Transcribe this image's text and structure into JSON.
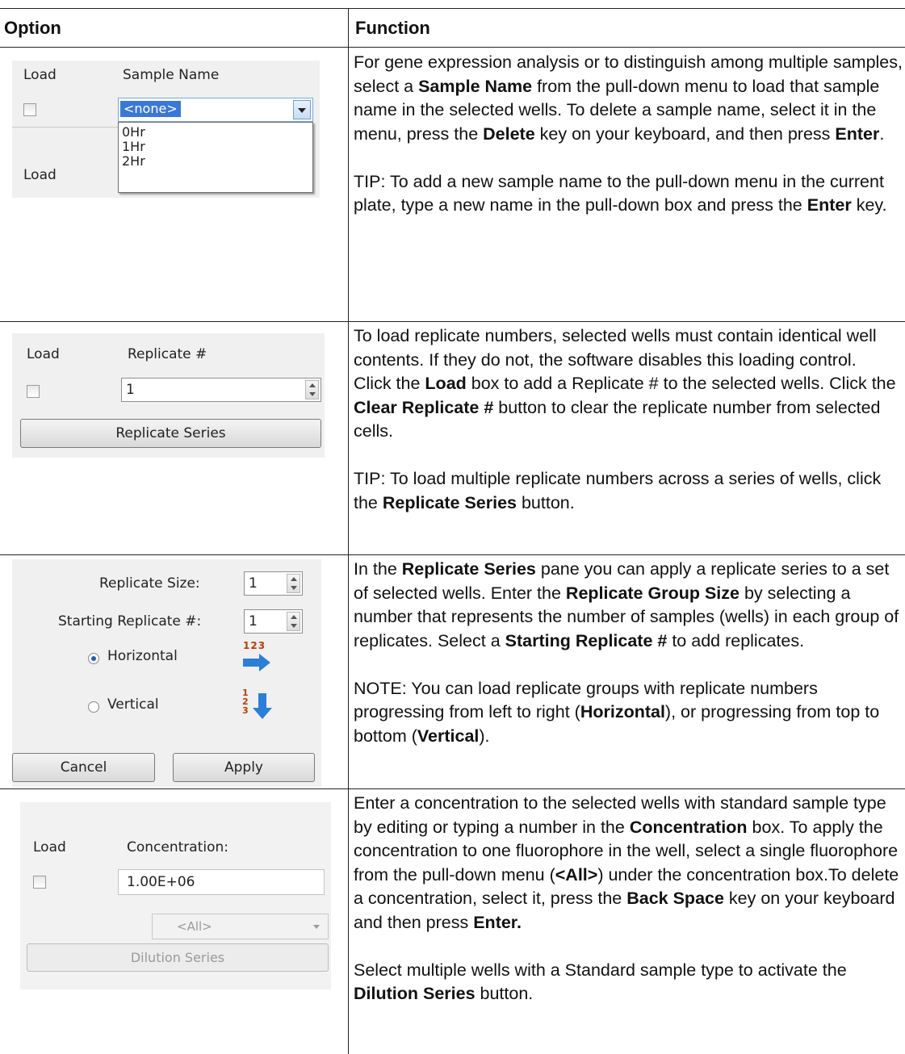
{
  "header": {
    "option": "Option",
    "function": "Function"
  },
  "rows": [
    {
      "shot": {
        "load_label": "Load",
        "sample_name_label": "Sample Name",
        "selected_value": "<none>",
        "options": [
          "0Hr",
          "1Hr",
          "2Hr"
        ],
        "load_label_2": "Load"
      },
      "text": {
        "p1_a": "For gene expression analysis or to distinguish among multiple samples, select a ",
        "p1_b1": "Sample Name",
        "p1_c": " from the pull-down menu to load that sample name in the selected wells. To delete a sample name, select it in the menu, press the ",
        "p1_b2": "Delete",
        "p1_d": " key on your keyboard, and then press ",
        "p1_b3": "Enter",
        "p1_e": ".",
        "p2_a": "TIP: To add a new sample name to the pull-down menu in the current plate, type a new name in the pull-down box and press the ",
        "p2_b": "Enter",
        "p2_c": " key."
      }
    },
    {
      "shot": {
        "load_label": "Load",
        "replicate_label": "Replicate #",
        "replicate_value": "1",
        "series_button": "Replicate Series"
      },
      "text": {
        "p1": "To load replicate numbers, selected wells must contain identical well contents. If they do not, the software disables this loading control.",
        "p2_a": "Click the ",
        "p2_b1": "Load",
        "p2_c": " box to add a Replicate # to the selected wells. Click the ",
        "p2_b2": "Clear Replicate #",
        "p2_d": " button to clear the replicate number from selected cells.",
        "p3_a": "TIP: To load multiple replicate numbers across a series of wells, click the ",
        "p3_b": "Replicate Series",
        "p3_c": " button."
      }
    },
    {
      "shot": {
        "size_label": "Replicate Size:",
        "size_value": "1",
        "start_label": "Starting Replicate #:",
        "start_value": "1",
        "horizontal_label": "Horizontal",
        "vertical_label": "Vertical",
        "horizontal_icon_text": "123",
        "vertical_icon_text": "123",
        "cancel_button": "Cancel",
        "apply_button": "Apply"
      },
      "text": {
        "p1_a": "In the ",
        "p1_b1": "Replicate Series",
        "p1_c": " pane you can apply a replicate series to a set of selected wells. Enter the ",
        "p1_b2": "Replicate Group Size",
        "p1_d": " by selecting a number that represents the number of samples (wells) in each group of replicates. Select a ",
        "p1_b3": "Starting Replicate #",
        "p1_e": " to add replicates.",
        "p2_a": "NOTE: You can load replicate groups with replicate numbers progressing from left to right (",
        "p2_b1": "Horizontal",
        "p2_c": "), or progressing from top to bottom (",
        "p2_b2": "Vertical",
        "p2_d": ")."
      }
    },
    {
      "shot": {
        "load_label": "Load",
        "concentration_label": "Concentration:",
        "concentration_value": "1.00E+06",
        "fluor_select": "<All>",
        "dilution_button": "Dilution Series"
      },
      "text": {
        "p1_a": "Enter a concentration to the selected wells with standard sample type by editing or typing a number in the ",
        "p1_b1": "Concentration",
        "p1_c": " box. To apply the concentration to one fluorophore in the well, select a single fluorophore from the pull-down menu (",
        "p1_b2": "<All>",
        "p1_d": ") under the concentration box.To delete a concentration, select it, press the ",
        "p1_b3": "Back Space",
        "p1_e": " key on your keyboard and then press ",
        "p1_b4": "Enter.",
        "p2_a": "Select multiple wells with a Standard sample type to activate the ",
        "p2_b": "Dilution Series",
        "p2_c": " button."
      }
    }
  ]
}
